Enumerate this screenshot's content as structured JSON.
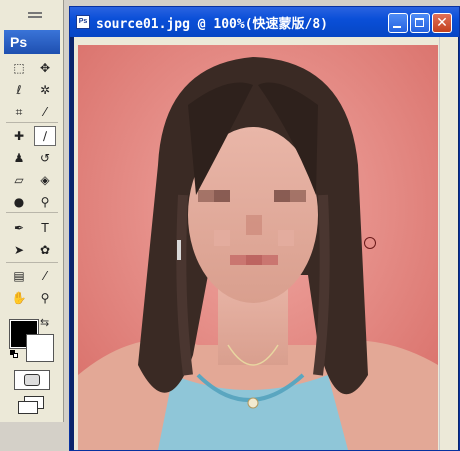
{
  "app": {
    "logo": "Ps"
  },
  "document": {
    "title": "source01.jpg @ 100%(快速蒙版/8)",
    "icon_label": "Ps"
  },
  "tools": [
    {
      "name": "marquee-tool",
      "glyph": "⬚"
    },
    {
      "name": "move-tool",
      "glyph": "✥"
    },
    {
      "name": "lasso-tool",
      "glyph": "ℓ"
    },
    {
      "name": "magic-wand-tool",
      "glyph": "✲"
    },
    {
      "name": "crop-tool",
      "glyph": "⌗"
    },
    {
      "name": "slice-tool",
      "glyph": "⁄"
    },
    {
      "name": "healing-brush-tool",
      "glyph": "✚"
    },
    {
      "name": "brush-tool",
      "glyph": "∕"
    },
    {
      "name": "clone-stamp-tool",
      "glyph": "♟"
    },
    {
      "name": "history-brush-tool",
      "glyph": "↺"
    },
    {
      "name": "eraser-tool",
      "glyph": "▱"
    },
    {
      "name": "paint-bucket-tool",
      "glyph": "◈"
    },
    {
      "name": "blur-tool",
      "glyph": "●"
    },
    {
      "name": "dodge-tool",
      "glyph": "⚲"
    },
    {
      "name": "pen-tool",
      "glyph": "✒"
    },
    {
      "name": "type-tool",
      "glyph": "T"
    },
    {
      "name": "path-selection-tool",
      "glyph": "➤"
    },
    {
      "name": "shape-tool",
      "glyph": "✿"
    },
    {
      "name": "notes-tool",
      "glyph": "▤"
    },
    {
      "name": "eyedropper-tool",
      "glyph": "⁄"
    },
    {
      "name": "hand-tool",
      "glyph": "✋"
    },
    {
      "name": "zoom-tool",
      "glyph": "⚲"
    }
  ],
  "colors": {
    "foreground": "#000000",
    "background": "#ffffff",
    "overlay": "#e08a86",
    "titlebar": "#0a4fd8"
  }
}
